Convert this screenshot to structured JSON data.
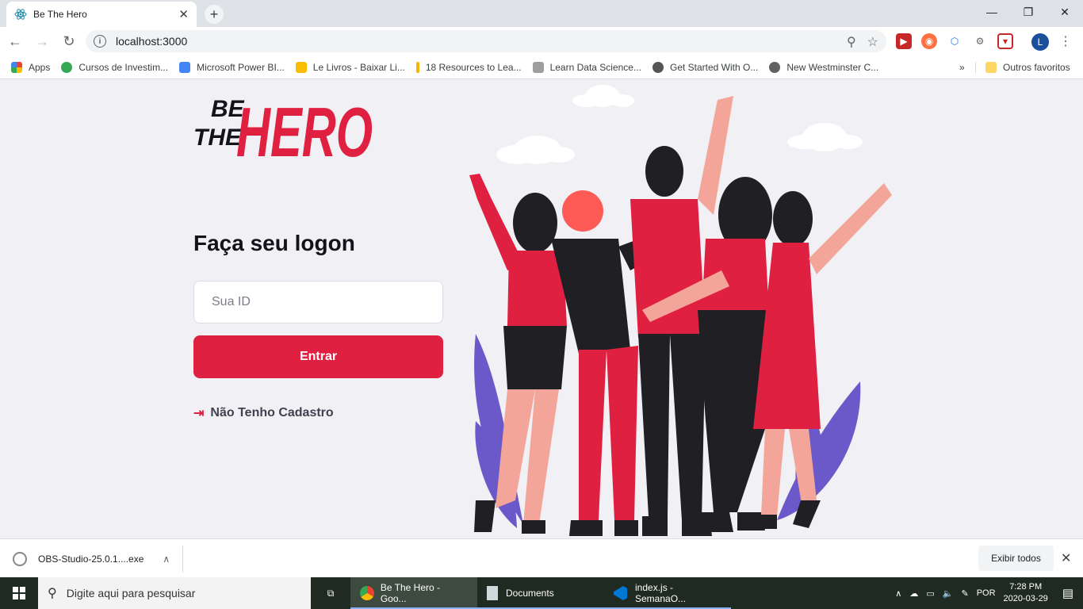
{
  "browser": {
    "tab_title": "Be The Hero",
    "url": "localhost:3000",
    "profile_initial": "L"
  },
  "bookmarks": [
    {
      "label": "Apps",
      "color": "#ea4335"
    },
    {
      "label": "Cursos de Investim...",
      "color": "#34a853"
    },
    {
      "label": "Microsoft Power BI...",
      "color": "#4285f4"
    },
    {
      "label": "Le Livros - Baixar Li...",
      "color": "#fbbc04"
    },
    {
      "label": "18 Resources to Lea...",
      "color": "#f4b400"
    },
    {
      "label": "Learn Data Science...",
      "color": "#9e9e9e"
    },
    {
      "label": "Get Started With O...",
      "color": "#555555"
    },
    {
      "label": "New Westminster C...",
      "color": "#616161"
    }
  ],
  "bookmarks_more": "»",
  "bookmarks_other": "Outros favoritos",
  "page": {
    "logo": {
      "be": "BE",
      "the": "THE",
      "hero": "HERO"
    },
    "title": "Faça seu logon",
    "id_placeholder": "Sua ID",
    "id_value": "",
    "enter_label": "Entrar",
    "register_label": "Não Tenho Cadastro",
    "accent": "#e02041"
  },
  "downloads": {
    "file": "OBS-Studio-25.0.1....exe",
    "show_all": "Exibir todos"
  },
  "taskbar": {
    "search_placeholder": "Digite aqui para pesquisar",
    "apps": [
      {
        "label": "Be The Hero - Goo...",
        "active": true
      },
      {
        "label": "Documents",
        "active": false
      },
      {
        "label": "index.js - SemanaO...",
        "active": false
      }
    ],
    "lang": "POR",
    "time": "7:28 PM",
    "date": "2020-03-29"
  }
}
